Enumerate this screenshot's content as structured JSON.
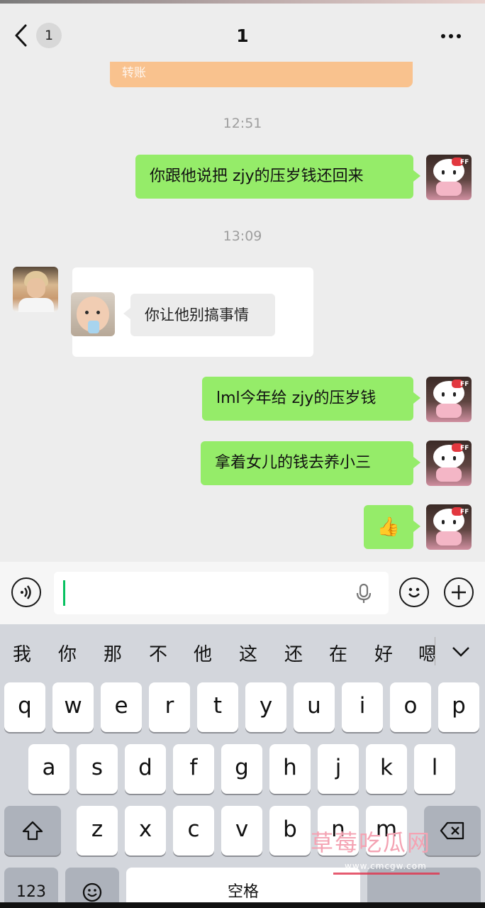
{
  "header": {
    "back_icon": "chevron-left",
    "unread_count": "1",
    "title": "1",
    "more_icon": "more-dots"
  },
  "messages": {
    "transfer_label": "转账",
    "time1": "12:51",
    "msg1": "你跟他说把 zjy的压岁钱还回来",
    "time2": "13:09",
    "quoted_text": "你让他别搞事情",
    "msg2": "lml今年给 zjy的压岁钱",
    "msg3": "拿着女儿的钱去养小三",
    "msg4": "👍",
    "kitty_tag": "FF"
  },
  "colors": {
    "sent_bubble": "#95ec69",
    "caret": "#07c160",
    "transfer": "#f9c28e"
  },
  "input": {
    "voice_icon": "voice-icon",
    "mic_icon": "mic-icon",
    "emoji_icon": "emoji-icon",
    "plus_icon": "plus-icon"
  },
  "keyboard": {
    "candidates": [
      "我",
      "你",
      "那",
      "不",
      "他",
      "这",
      "还",
      "在",
      "好",
      "嗯"
    ],
    "row1": [
      "q",
      "w",
      "e",
      "r",
      "t",
      "y",
      "u",
      "i",
      "o",
      "p"
    ],
    "row2": [
      "a",
      "s",
      "d",
      "f",
      "g",
      "h",
      "j",
      "k",
      "l"
    ],
    "row3": [
      "z",
      "x",
      "c",
      "v",
      "b",
      "n",
      "m"
    ],
    "numbers_label": "123",
    "space_label": "空格"
  },
  "watermark": {
    "text": "草莓吃瓜网",
    "url": "www.cmcgw.com"
  }
}
